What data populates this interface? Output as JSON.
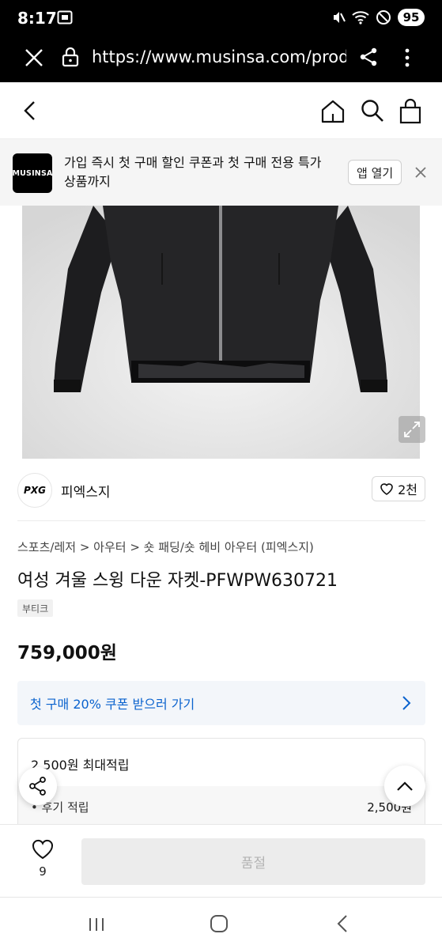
{
  "status": {
    "time": "8:17",
    "battery": "95"
  },
  "browser": {
    "url": "https://www.musinsa.com/produ"
  },
  "promo": {
    "logo_text": "MUSINSA",
    "message": "가입 즉시 첫 구매 할인 쿠폰과 첫 구매 전용 특가 상품까지",
    "open_app_label": "앱 열기"
  },
  "brand": {
    "logo_text": "PXG",
    "name": "피엑스지",
    "likes": "2천"
  },
  "product": {
    "breadcrumb": "스포츠/레저 > 아우터 > 숏 패딩/숏 헤비 아우터 (피엑스지)",
    "title": "여성 겨울 스윙 다운 자켓-PFWPW630721",
    "tag": "부티크",
    "price": "759,000원"
  },
  "coupon": {
    "label": "첫 구매 20% 쿠폰 받으러 가기"
  },
  "points": {
    "title": "2,500원 최대적립",
    "row_label": "• 후기 적립",
    "row_value": "2,500원"
  },
  "bottom": {
    "wish_count": "9",
    "buy_label": "품절"
  },
  "icons": {
    "status_left": "screenshot-icon",
    "status_right": [
      "mute-icon",
      "wifi-icon",
      "dnd-icon"
    ],
    "url": [
      "close-icon",
      "lock-icon",
      "share-icon",
      "menu-icon"
    ],
    "header": [
      "back-icon",
      "home-icon",
      "search-icon",
      "bag-icon"
    ]
  },
  "colors": {
    "coupon_text": "#0b63ce",
    "soldout_bg": "#ececec"
  }
}
